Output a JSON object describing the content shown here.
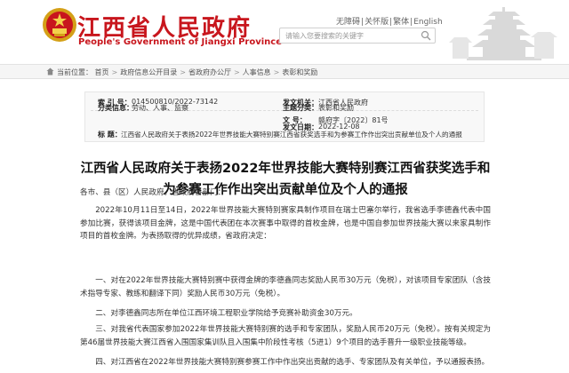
{
  "header": {
    "title": "江西省人民政府",
    "subtitle": "People's Government of Jiangxi Province",
    "top_links": [
      "无障碍",
      "关怀版",
      "繁体",
      "English"
    ],
    "search_placeholder": "请输入您要搜索的关键字"
  },
  "breadcrumb": {
    "label": "当前位置：",
    "items": [
      "首页",
      "政府信息公开目录",
      "省政府办公厅",
      "人事信息",
      "表彰和奖励"
    ]
  },
  "meta": {
    "index_label": "索 引 号：",
    "index_value": "014500810/2022-73142",
    "issuer_label": "发文机关：",
    "issuer_value": "江西省人民政府",
    "category_label": "分类信息：",
    "category_value": "劳动、人事、监察",
    "theme_label": "主题分类：",
    "theme_value": "表彰和奖励",
    "docno_label": "文 号：",
    "docno_value": "赣府字〔2022〕81号",
    "date_label": "发文日期：",
    "date_value": "2022-12-08",
    "subject_label": "标 题：",
    "subject_value": "江西省人民政府关于表扬2022年世界技能大赛特别赛江西省获奖选手和为参赛工作作出突出贡献单位及个人的通报"
  },
  "article": {
    "title": "江西省人民政府关于表扬2022年世界技能大赛特别赛江西省获奖选手和为参赛工作作出突出贡献单位及个人的通报",
    "salutation": "各市、县（区）人民政府，省政府各部门：",
    "p1": "2022年10月11日至14日，2022年世界技能大赛特别赛家具制作项目在瑞士巴塞尔举行，我省选手李德鑫代表中国参加比赛，获得该项目金牌，这是中国代表团在本次赛事中取得的首枚金牌，也是中国自参加世界技能大赛以来家具制作项目的首枚金牌。为表扬取得的优异成绩，省政府决定：",
    "p2": "一、对在2022年世界技能大赛特别赛中获得金牌的李德鑫同志奖励人民币30万元（免税），对该项目专家团队（含技术指导专家、教练和翻译下同）奖励人民币30万元（免税）。",
    "p3": "二、对李德鑫同志所在单位江西环境工程职业学院给予竞赛补助资金30万元。",
    "p4": "三、对我省代表国家参加2022年世界技能大赛特别赛的选手和专家团队，奖励人民币20万元（免税）。按有关规定为第46届世界技能大赛江西省入围国家集训队且入围集中阶段性考核（5进1）9个项目的选手晋升一级职业技能等级。",
    "p5": "四、对江西省在2022年世界技能大赛特别赛参赛工作中作出突出贡献的选手、专家团队及有关单位，予以通报表扬。"
  },
  "colors": {
    "brand_red": "#c8161d",
    "meta_value": "#c0392b"
  }
}
